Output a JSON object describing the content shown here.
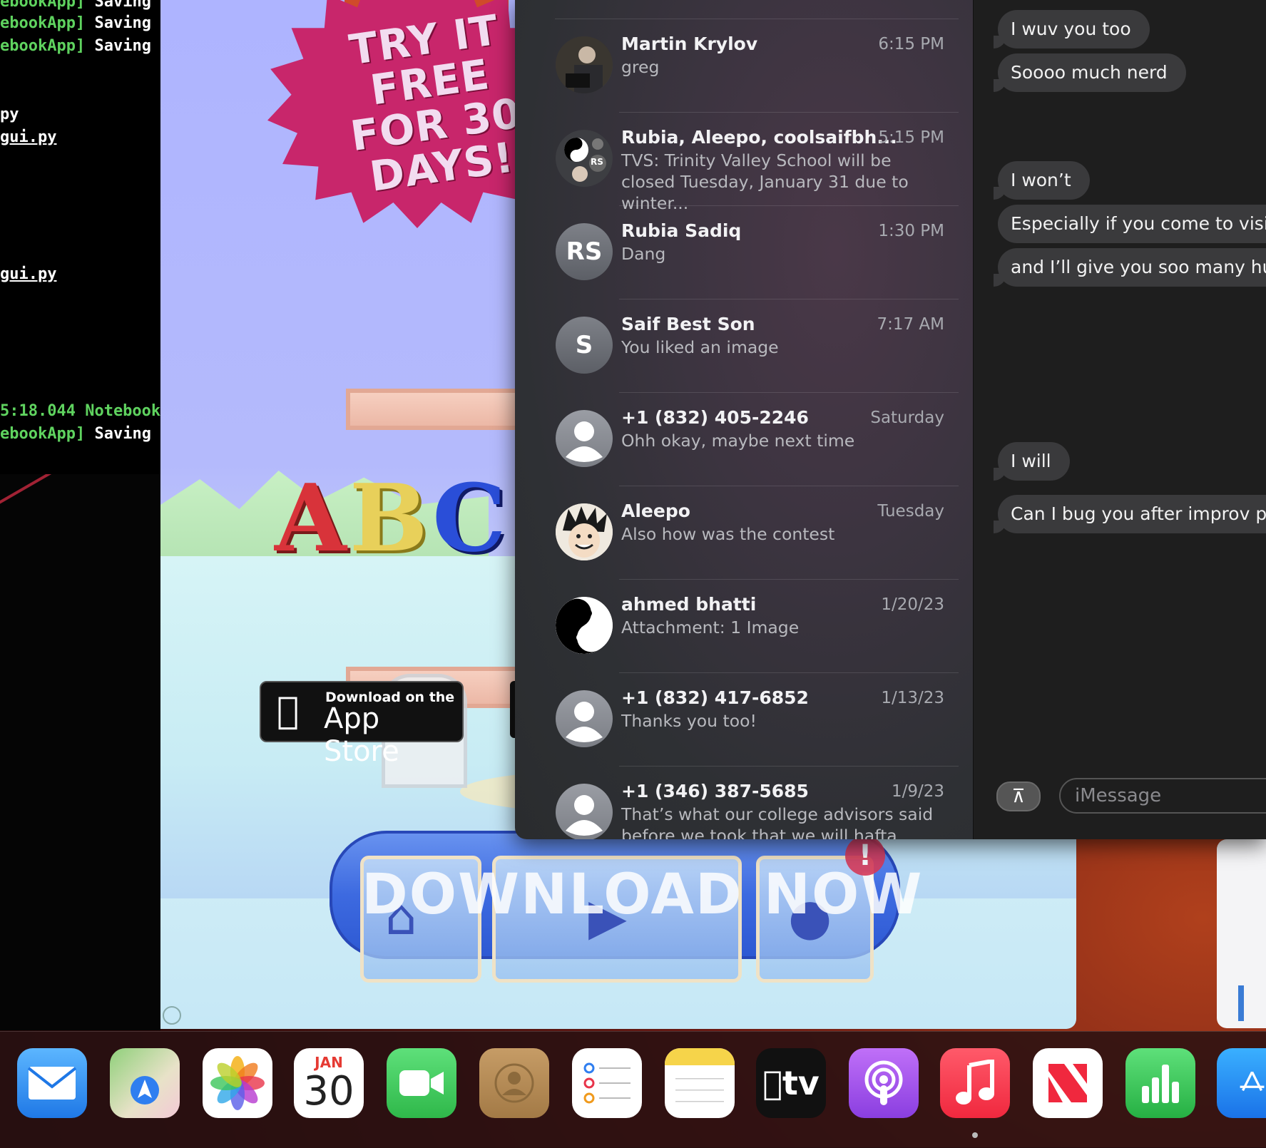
{
  "terminal": {
    "lines": [
      {
        "green": "ebookApp]",
        "white": " Saving"
      },
      {
        "green": "ebookApp]",
        "white": " Saving"
      },
      {
        "green": "ebookApp]",
        "white": " Saving"
      },
      {
        "white": "py"
      },
      {
        "underline": "gui.py"
      },
      {
        "underline": "gui.py"
      },
      {
        "green": "5:18.044 Notebook"
      },
      {
        "green": "ebookApp]",
        "white": " Saving"
      }
    ]
  },
  "ad": {
    "promo": "TRY IT FREE FOR 30 DAYS!",
    "abc_letters": [
      "A",
      "B",
      "C"
    ],
    "appstore_badge_small": "Download on the",
    "appstore_badge_big": "App Store",
    "download_button": "DOWNLOAD NOW",
    "alert_mark": "!"
  },
  "messages": {
    "conversations": [
      {
        "name": "Martin Krylov",
        "time": "6:15 PM",
        "preview": "greg",
        "avatar": "photo"
      },
      {
        "name": "Rubia, Aleepo, coolsaifbh...",
        "time": "5:15 PM",
        "preview": "TVS: Trinity Valley School will be closed Tuesday, January 31 due to winter...",
        "avatar": "group",
        "avatar_initials": "RS"
      },
      {
        "name": "Rubia Sadiq",
        "time": "1:30 PM",
        "preview": "Dang",
        "avatar": "initials",
        "avatar_initials": "RS"
      },
      {
        "name": "Saif Best Son",
        "time": "7:17 AM",
        "preview": "You liked an image",
        "avatar": "initials",
        "avatar_initials": "S"
      },
      {
        "name": "+1 (832) 405-2246",
        "time": "Saturday",
        "preview": "Ohh okay, maybe next time",
        "avatar": "generic"
      },
      {
        "name": "Aleepo",
        "time": "Tuesday",
        "preview": "Also how was the contest",
        "avatar": "anime"
      },
      {
        "name": "ahmed bhatti",
        "time": "1/20/23",
        "preview": "Attachment: 1 Image",
        "avatar": "yinyang"
      },
      {
        "name": "+1 (832) 417-6852",
        "time": "1/13/23",
        "preview": "Thanks you too!",
        "avatar": "generic"
      },
      {
        "name": "+1 (346) 387-5685",
        "time": "1/9/23",
        "preview": "That’s what our college advisors said before we took that we will hafta talk...",
        "avatar": "generic"
      }
    ],
    "chat_bubbles": [
      "I wuv you too",
      "Soooo much nerd",
      "I won’t",
      "Especially if you come to visit",
      "and I’ll give you soo many hug",
      "I will",
      "Can I bug you after improv ple"
    ],
    "input_placeholder": "iMessage",
    "appstore_button_icon": "app-store-icon"
  },
  "dock": {
    "apps": [
      {
        "name": "Mail",
        "icon": "mail-icon",
        "color": "#2f8cf0"
      },
      {
        "name": "Maps",
        "icon": "maps-icon",
        "color": "#7ecb6a"
      },
      {
        "name": "Photos",
        "icon": "photos-icon",
        "color": "#ffffff"
      },
      {
        "name": "Calendar",
        "icon": "calendar-icon",
        "color": "#ffffff",
        "month": "JAN",
        "day": "30"
      },
      {
        "name": "FaceTime",
        "icon": "facetime-icon",
        "color": "#3cc55a"
      },
      {
        "name": "Contacts",
        "icon": "contacts-icon",
        "color": "#b08a56"
      },
      {
        "name": "Reminders",
        "icon": "reminders-icon",
        "color": "#ffffff"
      },
      {
        "name": "Notes",
        "icon": "notes-icon",
        "color": "#ffffff"
      },
      {
        "name": "TV",
        "icon": "tv-icon",
        "color": "#111111",
        "label": "tv"
      },
      {
        "name": "Podcasts",
        "icon": "podcasts-icon",
        "color": "#9a4ee8"
      },
      {
        "name": "Music",
        "icon": "music-icon",
        "color": "#f2394e"
      },
      {
        "name": "News",
        "icon": "news-icon",
        "color": "#ffffff"
      },
      {
        "name": "Numbers",
        "icon": "numbers-icon",
        "color": "#2fbf4a"
      },
      {
        "name": "App Store",
        "icon": "app-store-icon",
        "color": "#1f8ef5"
      }
    ]
  }
}
